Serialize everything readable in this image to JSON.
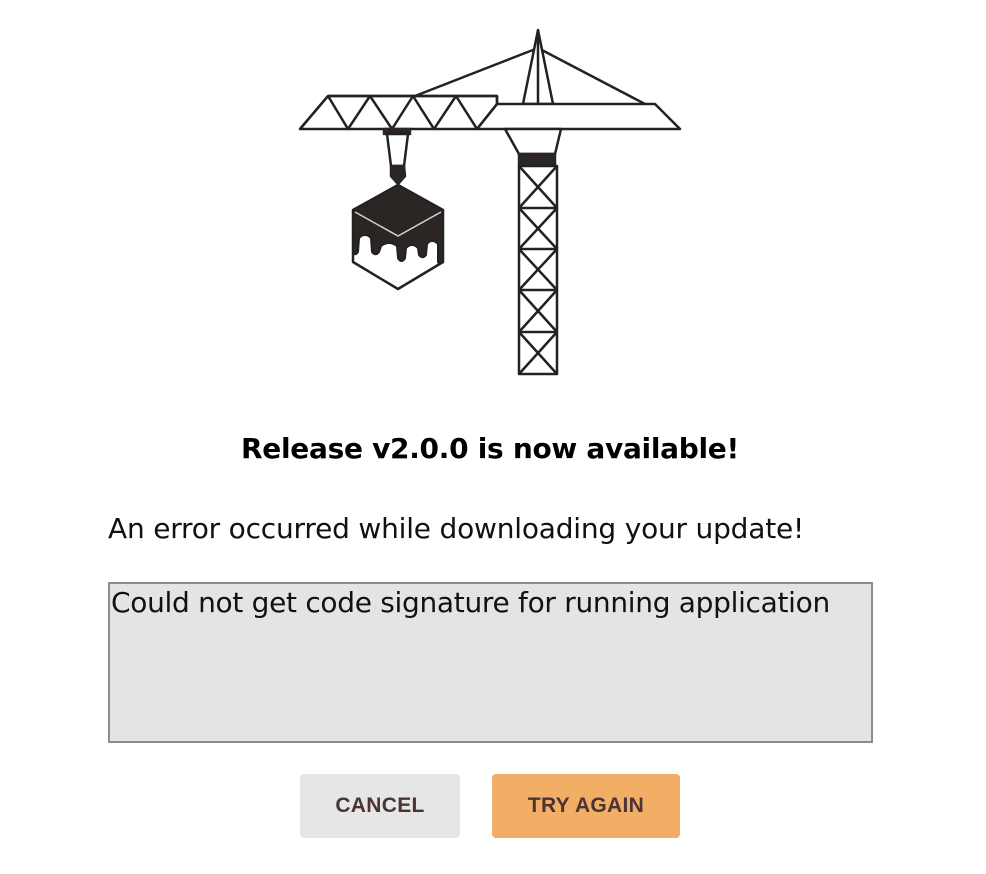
{
  "dialog": {
    "title": "Release v2.0.0 is now available!",
    "message": "An error occurred while downloading your update!",
    "details": "Could not get code signature for running application"
  },
  "buttons": {
    "cancel_label": "CANCEL",
    "retry_label": "TRY AGAIN"
  },
  "illustration": {
    "icon": "construction-crane-icon",
    "cargo_icon": "dripping-cube-icon"
  },
  "colors": {
    "retry_button": "#f2ae64",
    "cancel_button": "#e6e6e6",
    "details_background": "#e4e4e4",
    "button_text": "#4a3434"
  }
}
